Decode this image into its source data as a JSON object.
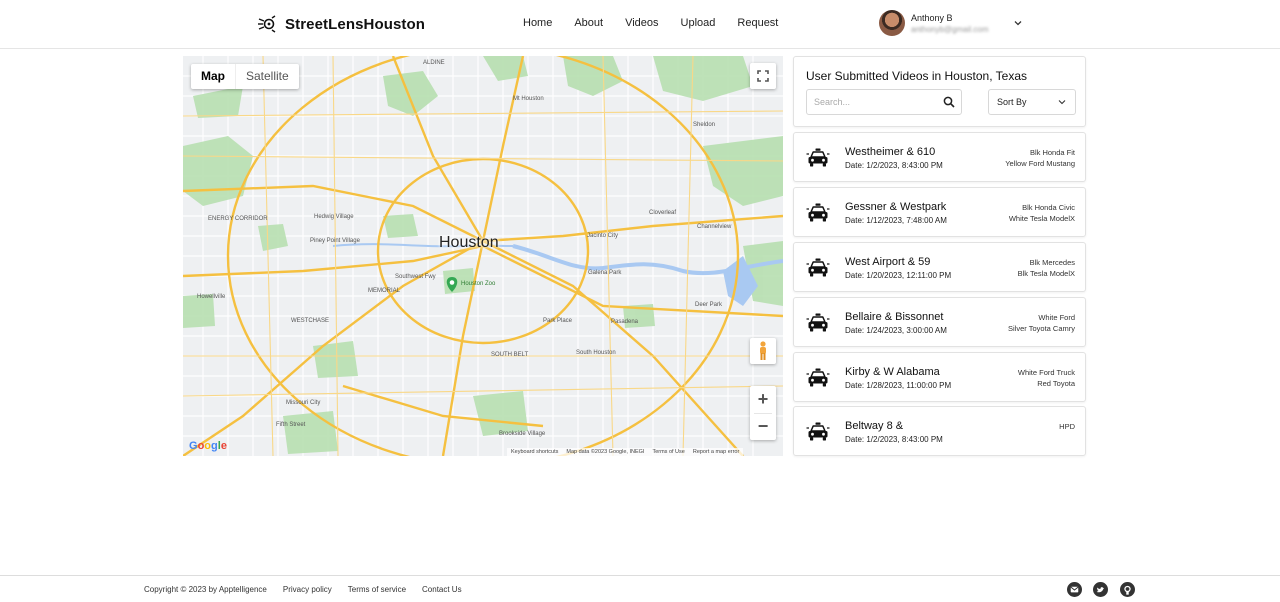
{
  "header": {
    "brand": "StreetLensHouston",
    "nav": [
      "Home",
      "About",
      "Videos",
      "Upload",
      "Request"
    ],
    "user_name": "Anthony B",
    "user_email": "anthonyb@gmail.com"
  },
  "map": {
    "tabs": [
      "Map",
      "Satellite"
    ],
    "active_tab": "Map",
    "city_label": "Houston",
    "place_labels": {
      "aldine": "ALDINE",
      "mt_houston": "Mt Houston",
      "sheldon": "Sheldon",
      "cloverleaf": "Cloverleaf",
      "channelview": "Channelview",
      "jacinto_city": "Jacinto City",
      "galena_park": "Galena Park",
      "deer_park": "Deer Park",
      "pasadena": "Pasadena",
      "park_place": "Park Place",
      "south_houston": "South Houston",
      "houston_zoo": "Houston Zoo",
      "hedwig_village": "Hedwig Village",
      "piney_point": "Piney Point Village",
      "energy_corridor": "ENERGY CORRIDOR",
      "howellville": "Howellville",
      "missouri_city": "Missouri City",
      "fifth_street": "Fifth Street",
      "brookside": "Brookside Village",
      "westchase": "WESTCHASE",
      "memorial": "MEMORIAL",
      "southwest_fwy": "Southwest Fwy",
      "south_belt": "SOUTH BELT"
    },
    "footer": [
      "Keyboard shortcuts",
      "Map data ©2023 Google, INEGI",
      "Terms of Use",
      "Report a map error"
    ],
    "logo_text": "Google"
  },
  "panel": {
    "title": "User Submitted Videos in Houston, Texas",
    "search_placeholder": "Search...",
    "sort_label": "Sort By"
  },
  "videos": [
    {
      "location": "Westheimer & 610",
      "date": "Date: 1/2/2023, 8:43:00 PM",
      "vehicles": [
        "Blk Honda Fit",
        "Yellow Ford Mustang"
      ]
    },
    {
      "location": "Gessner & Westpark",
      "date": "Date: 1/12/2023, 7:48:00 AM",
      "vehicles": [
        "Blk Honda Civic",
        "White Tesla ModelX"
      ]
    },
    {
      "location": "West Airport & 59",
      "date": "Date: 1/20/2023, 12:11:00 PM",
      "vehicles": [
        "Blk Mercedes",
        "Blk Tesla ModelX"
      ]
    },
    {
      "location": "Bellaire & Bissonnet",
      "date": "Date: 1/24/2023, 3:00:00 AM",
      "vehicles": [
        "White Ford",
        "Silver Toyota Camry"
      ]
    },
    {
      "location": "Kirby & W Alabama",
      "date": "Date: 1/28/2023, 11:00:00 PM",
      "vehicles": [
        "White Ford Truck",
        "Red Toyota"
      ]
    },
    {
      "location": "Beltway 8 &",
      "date": "Date: 1/2/2023, 8:43:00 PM",
      "vehicles": [
        "HPD",
        ""
      ]
    }
  ],
  "footer": {
    "links": [
      "Copyright © 2023 by Apptelligence",
      "Privacy policy",
      "Terms of service",
      "Contact Us"
    ],
    "social_icons": [
      "mail-icon",
      "twitter-icon",
      "github-icon"
    ]
  },
  "colors": {
    "highway": "#f5c040",
    "water": "#a9c9f2",
    "park": "#b7dfb0",
    "map_bg": "#eef0f2"
  }
}
